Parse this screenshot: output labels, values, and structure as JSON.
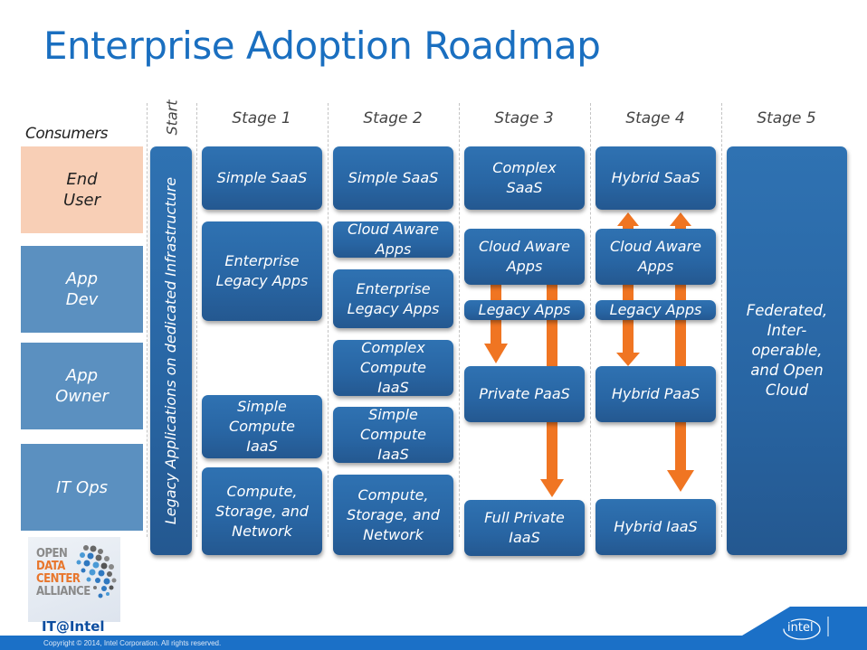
{
  "title": "Enterprise Adoption Roadmap",
  "consumers": {
    "label": "Consumers",
    "rows": [
      {
        "label": "End\nUser",
        "color": "#f8cfb6"
      },
      {
        "label": "App\nDev",
        "color": "#5b90c0"
      },
      {
        "label": "App\nOwner",
        "color": "#5b90c0"
      },
      {
        "label": "IT Ops",
        "color": "#5b90c0"
      }
    ]
  },
  "stages": {
    "start": "Start",
    "labels": [
      "Stage 1",
      "Stage 2",
      "Stage 3",
      "Stage 4",
      "Stage 5"
    ]
  },
  "start_column": {
    "text": "Legacy Applications on dedicated Infrastructure"
  },
  "stage1": {
    "boxes": [
      "Simple SaaS",
      "Enterprise\nLegacy Apps",
      "Simple\nCompute\nIaaS",
      "Compute,\nStorage, and\nNetwork"
    ]
  },
  "stage2": {
    "boxes": [
      "Simple SaaS",
      "Cloud Aware\nApps",
      "Enterprise\nLegacy Apps",
      "Complex\nCompute\nIaaS",
      "Simple\nCompute\nIaaS",
      "Compute,\nStorage, and\nNetwork"
    ]
  },
  "stage3": {
    "boxes": [
      "Complex\nSaaS",
      "Cloud Aware\nApps",
      "Legacy Apps",
      "Private PaaS",
      "Full  Private\nIaaS"
    ]
  },
  "stage4": {
    "boxes": [
      "Hybrid SaaS",
      "Cloud Aware\nApps",
      "Legacy Apps",
      "Hybrid PaaS",
      "Hybrid  IaaS"
    ]
  },
  "stage5": {
    "boxes": [
      "Federated,\nInter-\noperable,\nand Open\nCloud"
    ]
  },
  "colors": {
    "title": "#1a6fc0",
    "box": "#2b6aa8",
    "arrow": "#f07522",
    "peach": "#f8cfb6",
    "consumer_blue": "#5b90c0",
    "footer": "#1b70c7"
  },
  "logo": {
    "lines": [
      "OPEN",
      "DATA",
      "CENTER",
      "ALLIANCE"
    ]
  },
  "branding": {
    "it_at_intel": "IT@Intel",
    "intel": "intel",
    "copyright": "Copyright © 2014, Intel Corporation. All rights reserved."
  }
}
